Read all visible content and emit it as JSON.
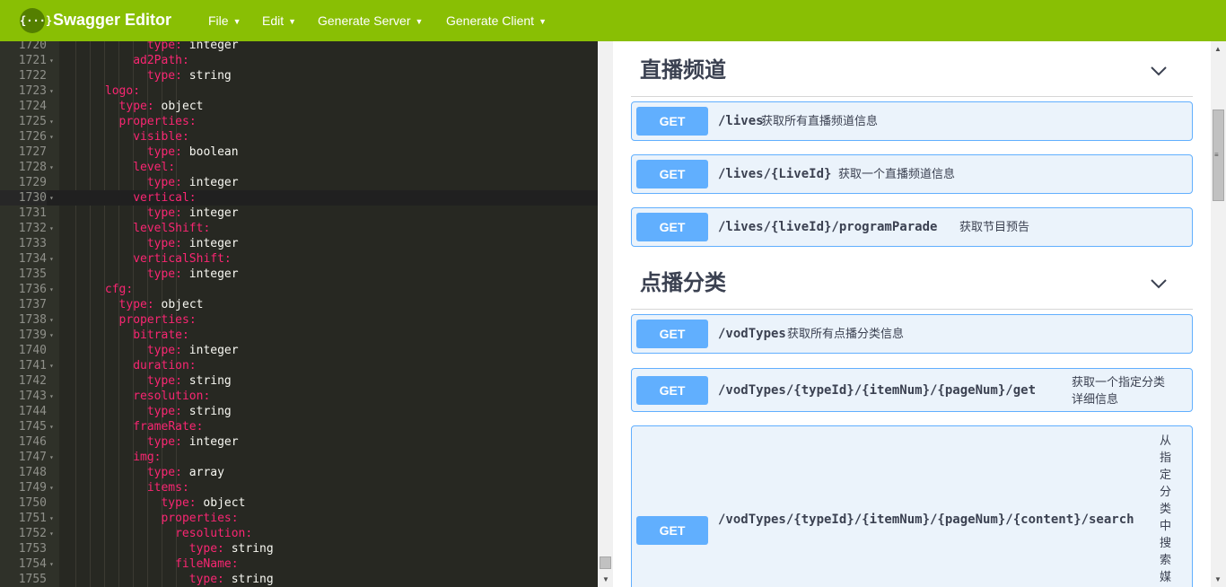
{
  "header": {
    "logo_glyph": "{···}",
    "title": "Swagger Editor",
    "menus": [
      {
        "label": "File"
      },
      {
        "label": "Edit"
      },
      {
        "label": "Generate Server"
      },
      {
        "label": "Generate Client"
      }
    ],
    "caret": "▼",
    "bg_color": "#89bf04"
  },
  "editor": {
    "active_line": 1730,
    "lines": [
      {
        "num": "1720",
        "key": "type:",
        "val": " integer",
        "indent": 12
      },
      {
        "num": "1721",
        "key": "ad2Path:",
        "val": "",
        "indent": 10,
        "fold": true
      },
      {
        "num": "1722",
        "key": "type:",
        "val": " string",
        "indent": 12
      },
      {
        "num": "1723",
        "key": "logo:",
        "val": "",
        "indent": 6,
        "fold": true
      },
      {
        "num": "1724",
        "key": "type:",
        "val": " object",
        "indent": 8
      },
      {
        "num": "1725",
        "key": "properties:",
        "val": "",
        "indent": 8,
        "fold": true
      },
      {
        "num": "1726",
        "key": "visible:",
        "val": "",
        "indent": 10,
        "fold": true
      },
      {
        "num": "1727",
        "key": "type:",
        "val": " boolean",
        "indent": 12
      },
      {
        "num": "1728",
        "key": "level:",
        "val": "",
        "indent": 10,
        "fold": true
      },
      {
        "num": "1729",
        "key": "type:",
        "val": " integer",
        "indent": 12
      },
      {
        "num": "1730",
        "key": "vertical:",
        "val": "",
        "indent": 10,
        "fold": true
      },
      {
        "num": "1731",
        "key": "type:",
        "val": " integer",
        "indent": 12
      },
      {
        "num": "1732",
        "key": "levelShift:",
        "val": "",
        "indent": 10,
        "fold": true
      },
      {
        "num": "1733",
        "key": "type:",
        "val": " integer",
        "indent": 12
      },
      {
        "num": "1734",
        "key": "verticalShift:",
        "val": "",
        "indent": 10,
        "fold": true
      },
      {
        "num": "1735",
        "key": "type:",
        "val": " integer",
        "indent": 12
      },
      {
        "num": "1736",
        "key": "cfg:",
        "val": "",
        "indent": 6,
        "fold": true
      },
      {
        "num": "1737",
        "key": "type:",
        "val": " object",
        "indent": 8
      },
      {
        "num": "1738",
        "key": "properties:",
        "val": "",
        "indent": 8,
        "fold": true
      },
      {
        "num": "1739",
        "key": "bitrate:",
        "val": "",
        "indent": 10,
        "fold": true
      },
      {
        "num": "1740",
        "key": "type:",
        "val": " integer",
        "indent": 12
      },
      {
        "num": "1741",
        "key": "duration:",
        "val": "",
        "indent": 10,
        "fold": true
      },
      {
        "num": "1742",
        "key": "type:",
        "val": " string",
        "indent": 12
      },
      {
        "num": "1743",
        "key": "resolution:",
        "val": "",
        "indent": 10,
        "fold": true
      },
      {
        "num": "1744",
        "key": "type:",
        "val": " string",
        "indent": 12
      },
      {
        "num": "1745",
        "key": "frameRate:",
        "val": "",
        "indent": 10,
        "fold": true
      },
      {
        "num": "1746",
        "key": "type:",
        "val": " integer",
        "indent": 12
      },
      {
        "num": "1747",
        "key": "img:",
        "val": "",
        "indent": 10,
        "fold": true
      },
      {
        "num": "1748",
        "key": "type:",
        "val": " array",
        "indent": 12
      },
      {
        "num": "1749",
        "key": "items:",
        "val": "",
        "indent": 12,
        "fold": true
      },
      {
        "num": "1750",
        "key": "type:",
        "val": " object",
        "indent": 14
      },
      {
        "num": "1751",
        "key": "properties:",
        "val": "",
        "indent": 14,
        "fold": true
      },
      {
        "num": "1752",
        "key": "resolution:",
        "val": "",
        "indent": 16,
        "fold": true
      },
      {
        "num": "1753",
        "key": "type:",
        "val": " string",
        "indent": 18
      },
      {
        "num": "1754",
        "key": "fileName:",
        "val": "",
        "indent": 16,
        "fold": true
      },
      {
        "num": "1755",
        "key": "type:",
        "val": " string",
        "indent": 18
      }
    ]
  },
  "sections": [
    {
      "title": "直播频道",
      "operations": [
        {
          "method": "GET",
          "path": "/lives",
          "summary": "获取所有直播频道信息"
        },
        {
          "method": "GET",
          "path": "/lives/{LiveId}",
          "summary": "获取一个直播频道信息"
        },
        {
          "method": "GET",
          "path": "/lives/{liveId}/programParade",
          "summary": "获取节目预告"
        }
      ]
    },
    {
      "title": "点播分类",
      "operations": [
        {
          "method": "GET",
          "path": "/vodTypes",
          "summary": "获取所有点播分类信息"
        },
        {
          "method": "GET",
          "path": "/vodTypes/{typeId}/{itemNum}/{pageNum}/get",
          "summary": "获取一个指定分类详细信息"
        },
        {
          "method": "GET",
          "path": "/vodTypes/{typeId}/{itemNum}/{pageNum}/{content}/search",
          "summary": "从指定分类中搜索媒体"
        }
      ]
    }
  ],
  "colors": {
    "get_method": "#61affe",
    "get_bg": "#ebf3fb",
    "yaml_key": "#f92672",
    "yaml_value": "#f8f8f2"
  }
}
